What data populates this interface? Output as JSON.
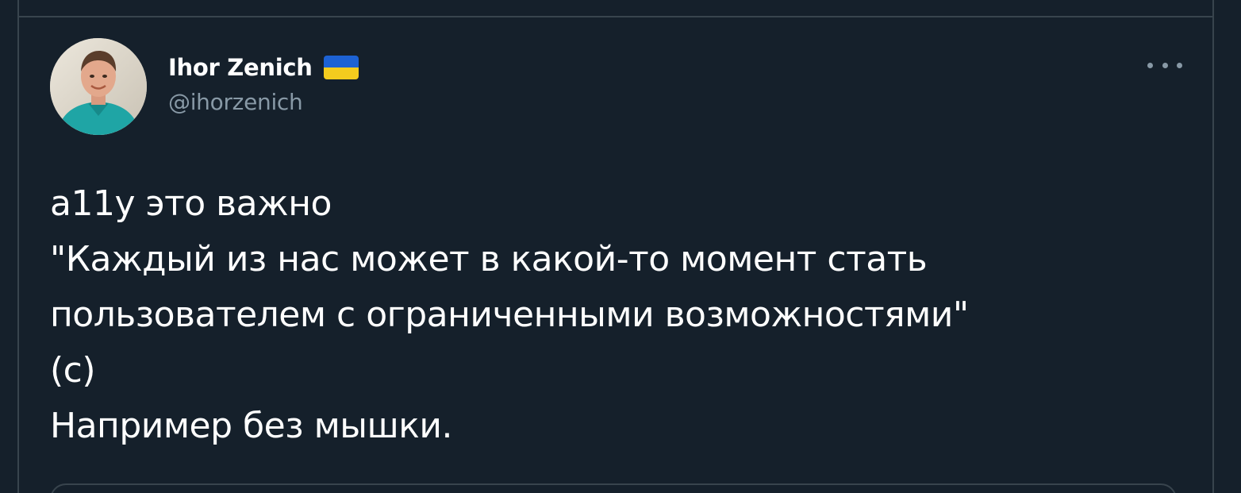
{
  "tweet": {
    "author": {
      "display_name": "Ihor Zenich",
      "handle": "@ihorzenich",
      "flag_icon": "ukraine-flag-icon",
      "flag_colors": [
        "#1d62d4",
        "#f4cc1e"
      ]
    },
    "more_icon": "more-horizontal-icon",
    "text_lines": [
      "a11y это важно",
      "\"Каждый из нас может в какой-то момент стать",
      "пользователем с ограниченными возможностями\"",
      "(с)",
      "Например без мышки."
    ]
  },
  "colors": {
    "background": "#15202b",
    "border": "#38444d",
    "secondary_text": "#8899a6",
    "primary_text": "#ffffff"
  }
}
